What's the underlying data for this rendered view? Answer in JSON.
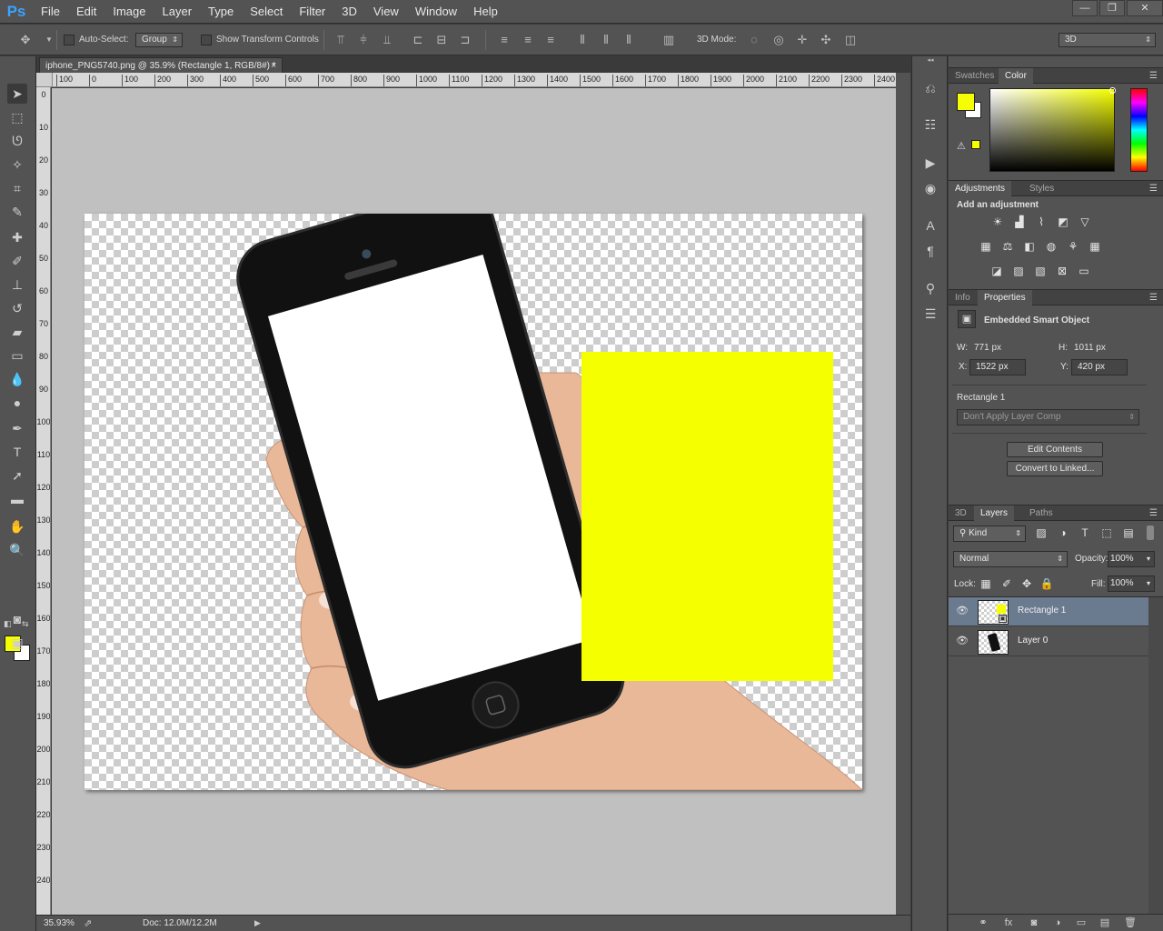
{
  "app": {
    "logo": "Ps"
  },
  "menu": [
    "File",
    "Edit",
    "Image",
    "Layer",
    "Type",
    "Select",
    "Filter",
    "3D",
    "View",
    "Window",
    "Help"
  ],
  "window_controls": {
    "minimize": "—",
    "restore": "❐",
    "close": "✕"
  },
  "options_bar": {
    "auto_select_label": "Auto-Select:",
    "auto_select_value": "Group",
    "show_transform_label": "Show Transform Controls",
    "mode_3d_label": "3D Mode:",
    "workspace_value": "3D"
  },
  "document": {
    "tab_title": "iphone_PNG5740.png @ 35.9% (Rectangle 1, RGB/8#) *",
    "close": "×"
  },
  "ruler": {
    "horizontal": [
      "100",
      "0",
      "100",
      "200",
      "300",
      "400",
      "500",
      "600",
      "700",
      "800",
      "900",
      "1000",
      "1100",
      "1200",
      "1300",
      "1400",
      "1500",
      "1600",
      "1700",
      "1800",
      "1900",
      "2000",
      "2100",
      "2200",
      "2300",
      "2400"
    ],
    "vertical": [
      "0",
      "1",
      "2",
      "3",
      "4",
      "5",
      "6",
      "7",
      "8",
      "9",
      "10",
      "11",
      "12",
      "13",
      "14",
      "15",
      "16",
      "17",
      "18",
      "19",
      "20",
      "21",
      "22",
      "23",
      "24"
    ]
  },
  "status": {
    "zoom": "35.93%",
    "doc": "Doc: 12.0M/12.2M"
  },
  "colors": {
    "foreground": "#f5ff00",
    "background": "#ffffff",
    "rect_fill": "#f5ff00",
    "selection": "#6a7a8f"
  },
  "color_panel": {
    "tabs": [
      "Swatches",
      "Color"
    ],
    "active": "Color"
  },
  "adjustments_panel": {
    "tabs": [
      "Adjustments",
      "Styles"
    ],
    "heading": "Add an adjustment"
  },
  "properties_panel": {
    "tabs": [
      "Info",
      "Properties"
    ],
    "type": "Embedded Smart Object",
    "w_label": "W:",
    "w_value": "771 px",
    "h_label": "H:",
    "h_value": "1011 px",
    "x_label": "X:",
    "x_value": "1522 px",
    "y_label": "Y:",
    "y_value": "420 px",
    "layer_name": "Rectangle 1",
    "layer_comp": "Don't Apply Layer Comp",
    "edit_contents": "Edit Contents",
    "convert_linked": "Convert to Linked..."
  },
  "layers_panel": {
    "tabs": [
      "3D",
      "Layers",
      "Paths"
    ],
    "kind_label": "Kind",
    "blend_mode": "Normal",
    "opacity_label": "Opacity:",
    "opacity_value": "100%",
    "lock_label": "Lock:",
    "fill_label": "Fill:",
    "fill_value": "100%",
    "layers": [
      {
        "name": "Rectangle 1",
        "selected": true
      },
      {
        "name": "Layer 0",
        "selected": false
      }
    ]
  }
}
